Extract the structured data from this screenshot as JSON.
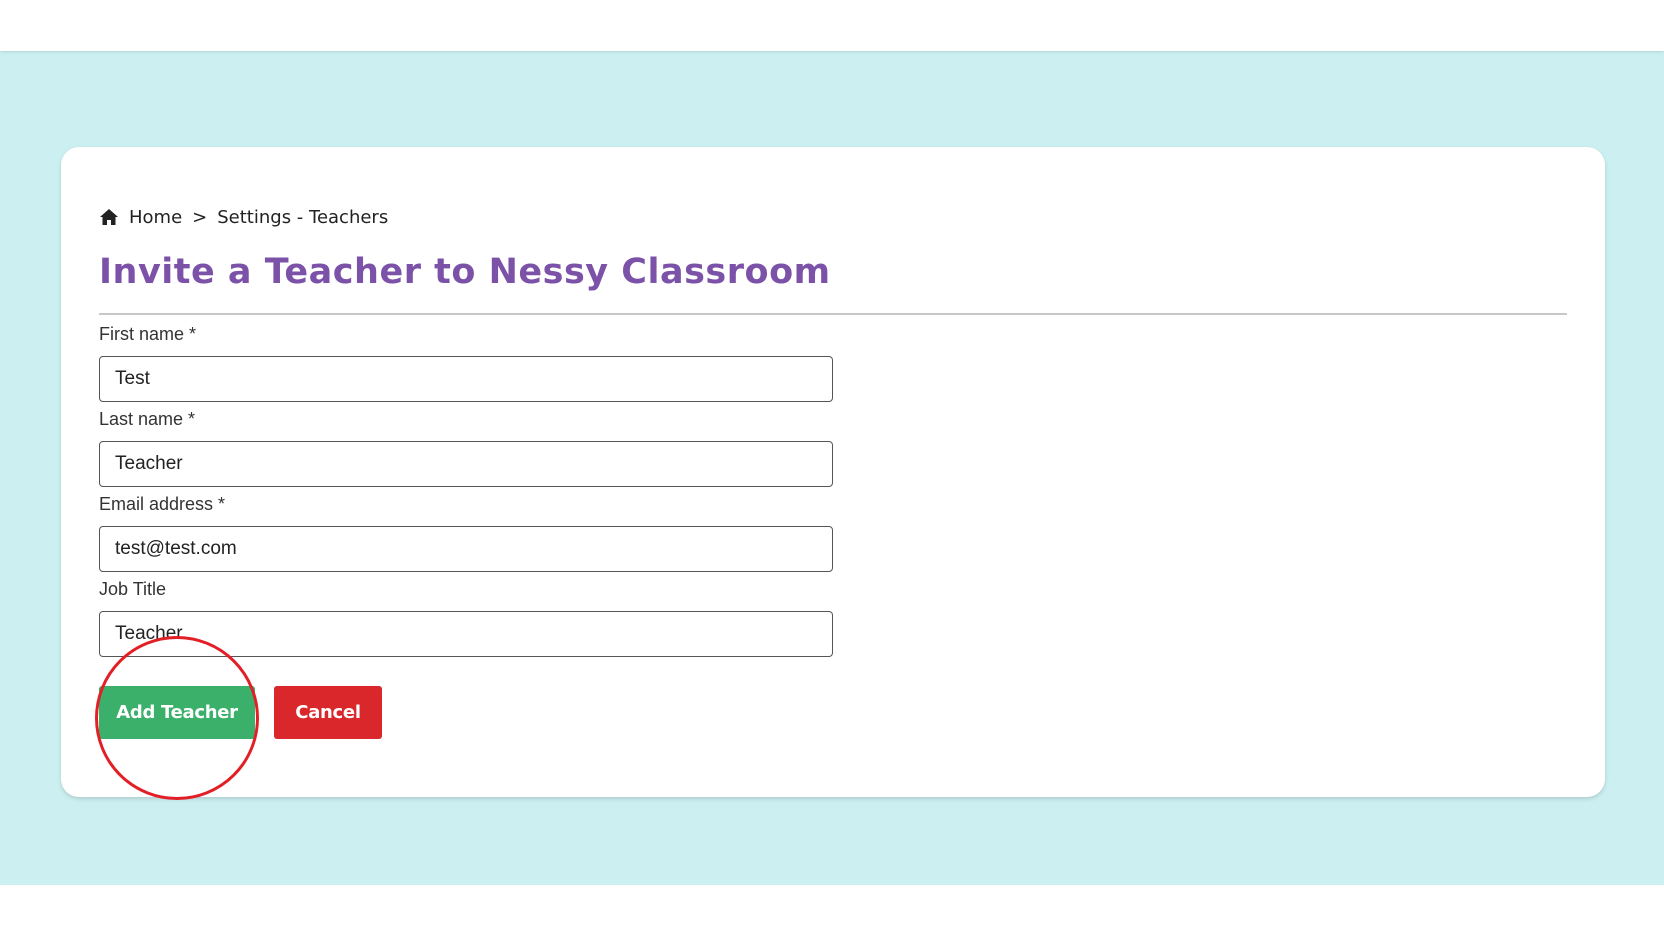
{
  "breadcrumb": {
    "home_icon": "home-icon",
    "home_label": "Home",
    "separator": ">",
    "current": "Settings - Teachers"
  },
  "page": {
    "title": "Invite a Teacher to Nessy Classroom"
  },
  "form": {
    "first_name": {
      "label": "First name *",
      "value": "Test"
    },
    "last_name": {
      "label": "Last name *",
      "value": "Teacher"
    },
    "email": {
      "label": "Email address *",
      "value": "test@test.com"
    },
    "job_title": {
      "label": "Job Title",
      "value": "Teacher"
    }
  },
  "actions": {
    "add_label": "Add Teacher",
    "cancel_label": "Cancel"
  },
  "colors": {
    "background": "#ccf0f1",
    "title": "#7b52a8",
    "add_button": "#3bb06a",
    "cancel_button": "#d9272b",
    "highlight": "#e21f26"
  }
}
